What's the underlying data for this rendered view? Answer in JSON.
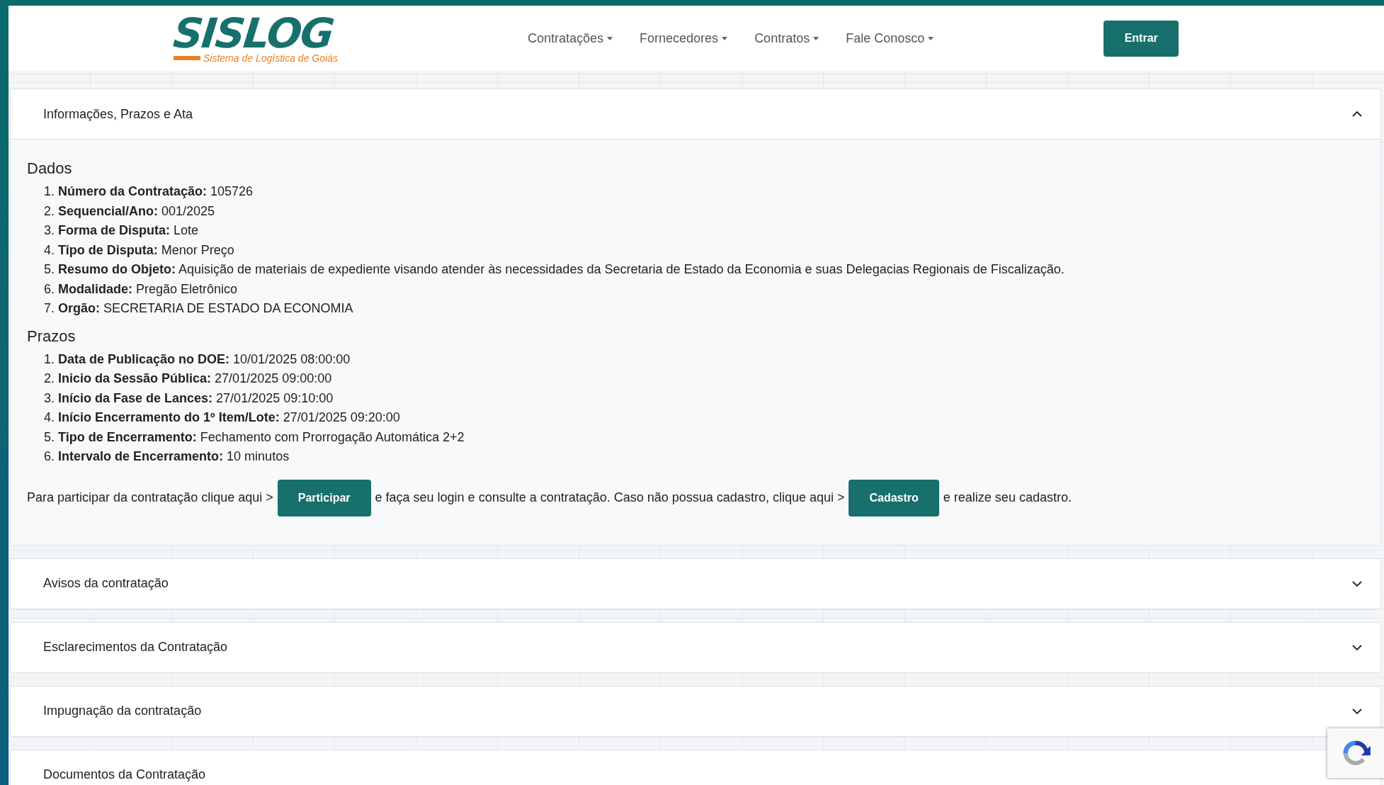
{
  "header": {
    "logo": {
      "name": "SISLOG",
      "tagline": "Sistema de Logística de Goiás"
    },
    "nav": [
      {
        "label": "Contratações"
      },
      {
        "label": "Fornecedores"
      },
      {
        "label": "Contratos"
      },
      {
        "label": "Fale Conosco"
      }
    ],
    "login_button": "Entrar"
  },
  "sections": [
    {
      "title": "Informações, Prazos e Ata",
      "expanded": true,
      "groups": [
        {
          "heading": "Dados",
          "markers": [
            "1.",
            "2.",
            "3.",
            "4.",
            "5.",
            "6.",
            "7."
          ],
          "items": [
            {
              "label": "Número da Contratação:",
              "value": "105726"
            },
            {
              "label": "Sequencial/Ano:",
              "value": "001/2025"
            },
            {
              "label": "Forma de Disputa:",
              "value": "Lote"
            },
            {
              "label": "Tipo de Disputa:",
              "value": "Menor Preço"
            },
            {
              "label": "Resumo do Objeto:",
              "value": "Aquisição de materiais de expediente visando atender às necessidades da Secretaria de Estado da Economia e suas Delegacias Regionais de Fiscalização."
            },
            {
              "label": "Modalidade:",
              "value": "Pregão Eletrônico"
            },
            {
              "label": "Orgão:",
              "value": "SECRETARIA DE ESTADO DA ECONOMIA"
            }
          ]
        },
        {
          "heading": "Prazos",
          "markers": [
            "1.",
            "2.",
            "3.",
            "4.",
            "5.",
            "6."
          ],
          "items": [
            {
              "label": "Data de Publicação no DOE:",
              "value": "10/01/2025 08:00:00"
            },
            {
              "label": "Inicio da Sessão Pública:",
              "value": "27/01/2025 09:00:00"
            },
            {
              "label": "Início da Fase de Lances:",
              "value": "27/01/2025 09:10:00"
            },
            {
              "label": "Início Encerramento do 1º Item/Lote:",
              "value": "27/01/2025 09:20:00"
            },
            {
              "label": "Tipo de Encerramento:",
              "value": "Fechamento com Prorrogação Automática 2+2"
            },
            {
              "label": "Intervalo de Encerramento:",
              "value": "10 minutos"
            }
          ]
        }
      ],
      "instructions": [
        {
          "kind": "text",
          "text": "Para participar da contratação clique aqui >"
        },
        {
          "kind": "button",
          "text": "Participar"
        },
        {
          "kind": "text",
          "text": "e faça seu login e consulte a contratação. Caso não possua cadastro, clique aqui >"
        },
        {
          "kind": "button",
          "text": "Cadastro"
        },
        {
          "kind": "text",
          "text": "e realize seu cadastro."
        }
      ]
    },
    {
      "title": "Avisos da contratação",
      "expanded": false
    },
    {
      "title": "Esclarecimentos da Contratação",
      "expanded": false
    },
    {
      "title": "Impugnação da contratação",
      "expanded": false
    },
    {
      "title": "Documentos da Contratação",
      "expanded": false
    }
  ]
}
